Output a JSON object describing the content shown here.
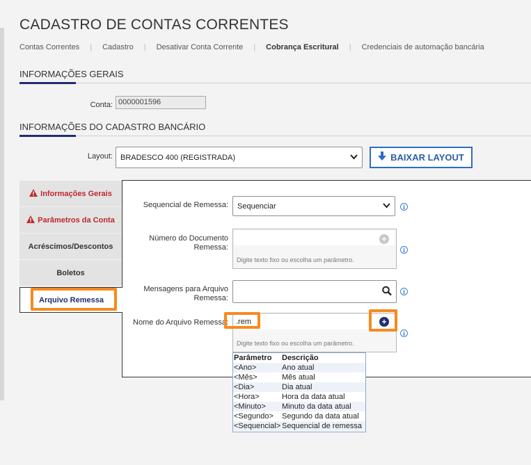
{
  "page": {
    "title": "CADASTRO DE CONTAS CORRENTES"
  },
  "breadcrumb": [
    {
      "label": "Contas Correntes",
      "active": false
    },
    {
      "label": "Cadastro",
      "active": false
    },
    {
      "label": "Desativar Conta Corrente",
      "active": false
    },
    {
      "label": "Cobrança Escritural",
      "active": true
    },
    {
      "label": "Credenciais de automação bancária",
      "active": false
    }
  ],
  "general_info": {
    "title": "INFORMAÇÕES GERAIS",
    "account_label": "Conta:",
    "account_value": "0000001596"
  },
  "bank_info": {
    "title": "INFORMAÇÕES DO CADASTRO BANCÁRIO",
    "layout_label": "Layout:",
    "layout_value": "BRADESCO 400 (REGISTRADA)",
    "download_button": "BAIXAR LAYOUT"
  },
  "tabs": [
    {
      "label": "Informações Gerais",
      "warning": true,
      "active": false
    },
    {
      "label": "Parâmetros da Conta",
      "warning": true,
      "active": false
    },
    {
      "label": "Acréscimos/Descontos",
      "warning": false,
      "active": false
    },
    {
      "label": "Boletos",
      "warning": false,
      "active": false
    },
    {
      "label": "Arquivo Remessa",
      "warning": false,
      "active": true
    }
  ],
  "form": {
    "sequencial_label": "Sequencial de Remessa:",
    "sequencial_value": "Sequenciar",
    "numero_doc_label": "Número do Documento Remessa:",
    "numero_doc_value": "",
    "numero_doc_hint": "Digite texto fixo ou escolha um parâmetro.",
    "mensagens_label": "Mensagens para Arquivo Remessa:",
    "mensagens_value": "",
    "nome_arquivo_label": "Nome do Arquivo Remessa:",
    "nome_arquivo_value": ".rem",
    "nome_arquivo_hint": "Digite texto fixo ou escolha um parâmetro."
  },
  "param_table": {
    "header": {
      "param": "Parâmetro",
      "desc": "Descrição"
    },
    "rows": [
      {
        "param": "<Ano>",
        "desc": "Ano atual"
      },
      {
        "param": "<Mês>",
        "desc": "Mês atual"
      },
      {
        "param": "<Dia>",
        "desc": "Dia atual"
      },
      {
        "param": "<Hora>",
        "desc": "Hora da data atual"
      },
      {
        "param": "<Minuto>",
        "desc": "Minuto da data atual"
      },
      {
        "param": "<Segundo>",
        "desc": "Segundo da data atual"
      },
      {
        "param": "<Sequencial>",
        "desc": "Sequencial de remessa"
      }
    ]
  },
  "colors": {
    "accent": "#1f2e6e",
    "warning": "#c0272d",
    "highlight": "#f68a1f",
    "link_blue": "#2b6cc4"
  },
  "icons": {
    "warning": "warning-triangle-icon",
    "info": "info-icon",
    "add": "plus-circle-icon",
    "search": "search-icon",
    "download": "download-arrow-icon",
    "dropdown": "chevron-down-icon"
  }
}
